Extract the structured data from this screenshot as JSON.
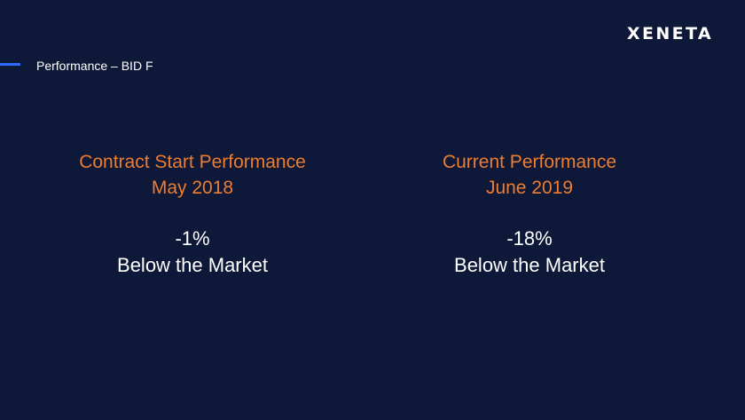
{
  "brand": {
    "logo_text": "XENETA"
  },
  "header": {
    "section_title": "Performance – BID F",
    "accent_color": "#2f6bff"
  },
  "theme": {
    "background": "#0e1838",
    "heading_color": "#ed7d31",
    "text_color": "#ffffff"
  },
  "panels": [
    {
      "heading_line1": "Contract Start Performance",
      "heading_line2": "May 2018",
      "value": "-1%",
      "caption": "Below the Market"
    },
    {
      "heading_line1": "Current Performance",
      "heading_line2": "June 2019",
      "value": "-18%",
      "caption": "Below the Market"
    }
  ]
}
